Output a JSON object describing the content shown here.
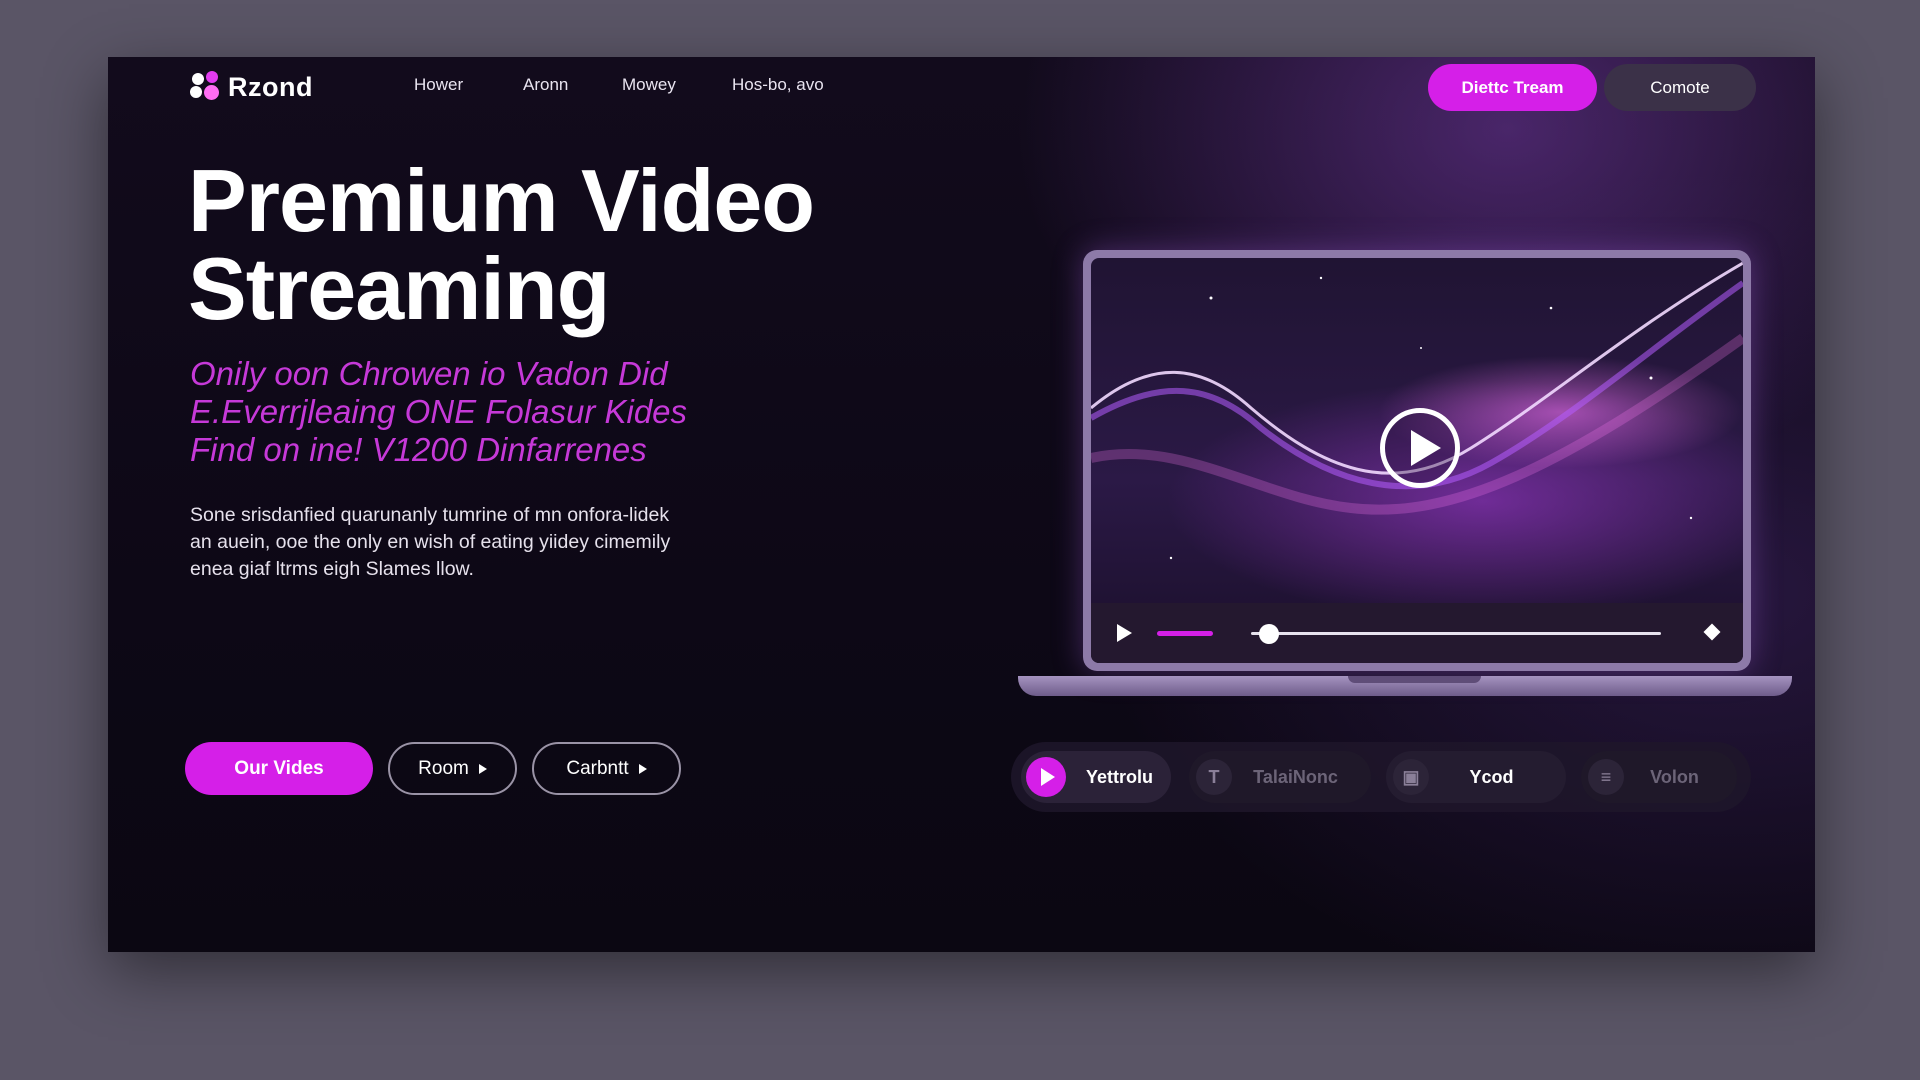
{
  "brand": {
    "name": "Rzond"
  },
  "nav": {
    "items": [
      "Hower",
      "Aronn",
      "Mowey",
      "Hos-bo, avo"
    ]
  },
  "header_buttons": {
    "primary": "Diettc Tream",
    "secondary": "Comote"
  },
  "hero": {
    "title_line1": "Premium Video",
    "title_line2": "Streaming",
    "subtitle_line1": "Onily oon Chrowen io Vadon Did",
    "subtitle_line2": "E.Everrjleaing ONE Folasur Kides",
    "subtitle_line3": "Find on ine! V1200 Dinfarrenes",
    "body_line1": "Sone srisdanfied quarunanly tumrine of mn onfora-lidek",
    "body_line2": "an auein, ooe the only en wish of eating yiidey cimemily",
    "body_line3": "enea giaf ltrms eigh Slames llow."
  },
  "cta": {
    "primary": "Our Vides",
    "second": "Room",
    "third": "Carbntt"
  },
  "player": {
    "progress_fraction": 0.1,
    "accent": "#d51fe8"
  },
  "categories": [
    {
      "label": "Yettrolu",
      "icon": "play-icon",
      "active": true
    },
    {
      "label": "TalaiNonc",
      "icon": "t-icon",
      "glyph": "T",
      "active": false
    },
    {
      "label": "Ycod",
      "icon": "media-icon",
      "glyph": "▣",
      "active": false
    },
    {
      "label": "Volon",
      "icon": "stats-icon",
      "glyph": "≡",
      "active": false
    }
  ],
  "colors": {
    "accent": "#d51fe8",
    "background": "#0d0816",
    "subtitle": "#c639d8"
  }
}
